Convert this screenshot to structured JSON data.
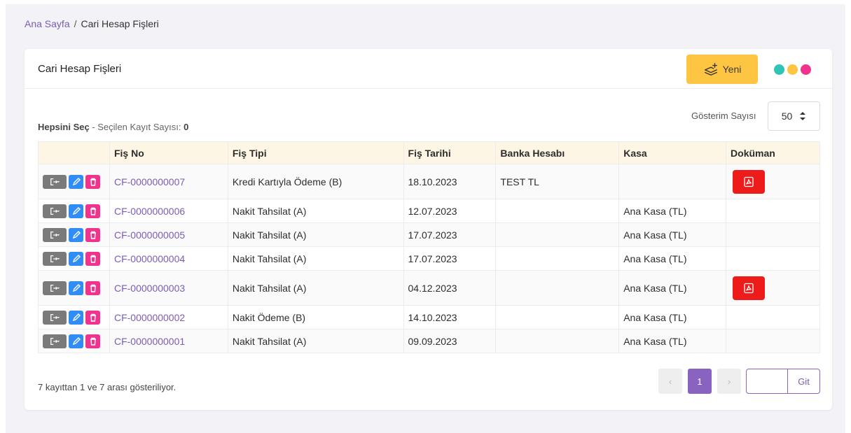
{
  "breadcrumb": {
    "home": "Ana Sayfa",
    "separator": "/",
    "current": "Cari Hesap Fişleri"
  },
  "card": {
    "title": "Cari Hesap Fişleri",
    "new_button": "Yeni"
  },
  "theme_dots": [
    "#2ec4b6",
    "#fdc542",
    "#f0338c"
  ],
  "selection": {
    "select_all": "Hepsini Seç",
    "separator": " - ",
    "count_label": "Seçilen Kayıt Sayısı:",
    "count": "0"
  },
  "page_size": {
    "label": "Gösterim Sayısı",
    "value": "50"
  },
  "table": {
    "columns": [
      "",
      "Fiş No",
      "Fiş Tipi",
      "Fiş Tarihi",
      "Banka Hesabı",
      "Kasa",
      "Doküman"
    ],
    "rows": [
      {
        "fis_no": "CF-0000000007",
        "fis_tipi": "Kredi Kartıyla Ödeme (B)",
        "tarih": "18.10.2023",
        "banka": "TEST TL",
        "kasa": "",
        "has_doc": true
      },
      {
        "fis_no": "CF-0000000006",
        "fis_tipi": "Nakit Tahsilat (A)",
        "tarih": "12.07.2023",
        "banka": "",
        "kasa": "Ana Kasa (TL)",
        "has_doc": false
      },
      {
        "fis_no": "CF-0000000005",
        "fis_tipi": "Nakit Tahsilat (A)",
        "tarih": "17.07.2023",
        "banka": "",
        "kasa": "Ana Kasa (TL)",
        "has_doc": false
      },
      {
        "fis_no": "CF-0000000004",
        "fis_tipi": "Nakit Tahsilat (A)",
        "tarih": "17.07.2023",
        "banka": "",
        "kasa": "Ana Kasa (TL)",
        "has_doc": false
      },
      {
        "fis_no": "CF-0000000003",
        "fis_tipi": "Nakit Tahsilat (A)",
        "tarih": "04.12.2023",
        "banka": "",
        "kasa": "Ana Kasa (TL)",
        "has_doc": true
      },
      {
        "fis_no": "CF-0000000002",
        "fis_tipi": "Nakit Ödeme (B)",
        "tarih": "14.10.2023",
        "banka": "",
        "kasa": "Ana Kasa (TL)",
        "has_doc": false
      },
      {
        "fis_no": "CF-0000000001",
        "fis_tipi": "Nakit Tahsilat (A)",
        "tarih": "09.09.2023",
        "banka": "",
        "kasa": "Ana Kasa (TL)",
        "has_doc": false
      }
    ]
  },
  "footer": {
    "info": "7 kayıttan 1 ve 7 arası gösteriliyor."
  },
  "pagination": {
    "prev": "‹",
    "current": "1",
    "next": "›",
    "goto_value": "",
    "goto_button": "Git"
  },
  "colors": {
    "accent": "#7c5cb5",
    "new_button": "#fdc542",
    "pdf": "#ee1b1b",
    "edit": "#2f8df5",
    "delete": "#f0338c",
    "export": "#7a7a7a"
  }
}
